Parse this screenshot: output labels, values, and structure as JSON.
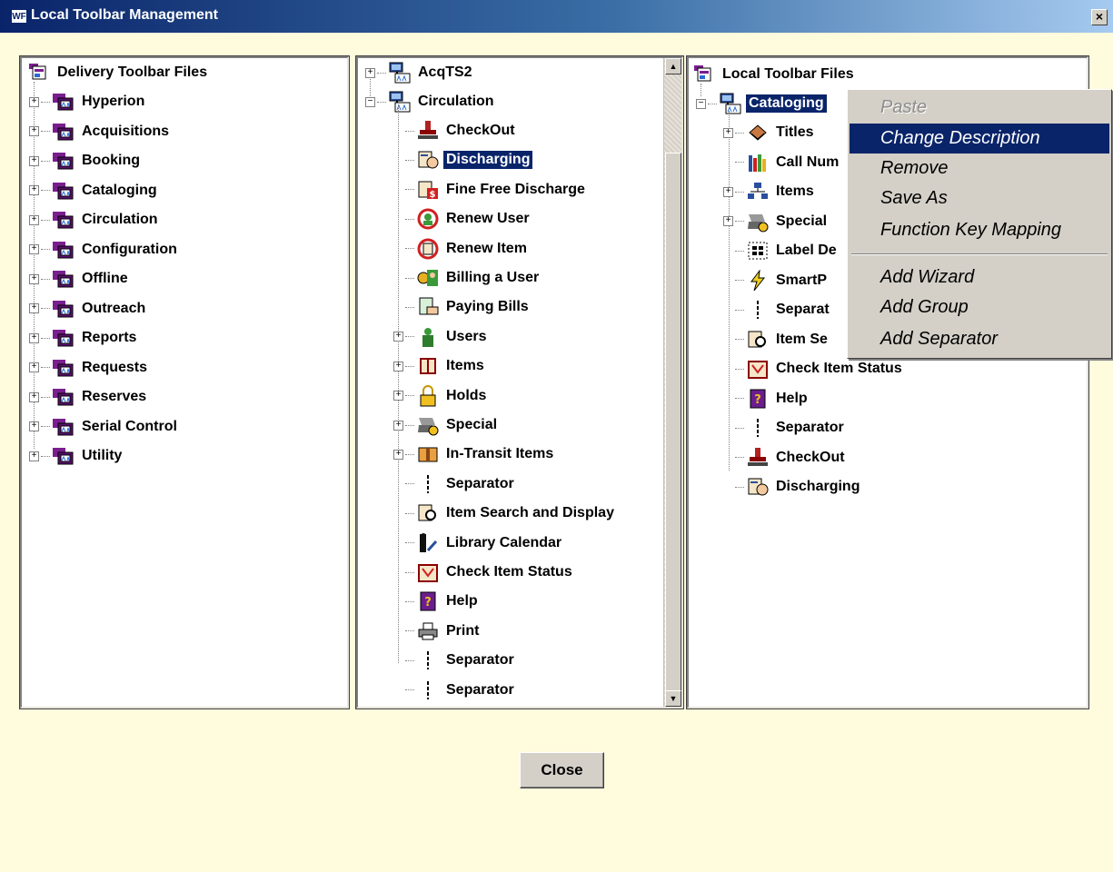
{
  "window": {
    "title": "Local Toolbar Management",
    "app_icon_text": "WF",
    "close_glyph": "×"
  },
  "left_panel": {
    "root": {
      "label": "Delivery Toolbar Files",
      "icon": "toolbar-files-icon"
    },
    "items": [
      {
        "label": "Hyperion",
        "icon": "toolbar-icon",
        "expanded": false
      },
      {
        "label": "Acquisitions",
        "icon": "toolbar-icon",
        "expanded": false
      },
      {
        "label": "Booking",
        "icon": "toolbar-icon",
        "expanded": false
      },
      {
        "label": "Cataloging",
        "icon": "toolbar-icon",
        "expanded": false
      },
      {
        "label": "Circulation",
        "icon": "toolbar-icon",
        "expanded": false
      },
      {
        "label": "Configuration",
        "icon": "toolbar-icon",
        "expanded": false
      },
      {
        "label": "Offline",
        "icon": "toolbar-icon",
        "expanded": false
      },
      {
        "label": "Outreach",
        "icon": "toolbar-icon",
        "expanded": false
      },
      {
        "label": "Reports",
        "icon": "toolbar-icon",
        "expanded": false
      },
      {
        "label": "Requests",
        "icon": "toolbar-icon",
        "expanded": false
      },
      {
        "label": "Reserves",
        "icon": "toolbar-icon",
        "expanded": false
      },
      {
        "label": "Serial Control",
        "icon": "toolbar-icon",
        "expanded": false
      },
      {
        "label": "Utility",
        "icon": "toolbar-icon",
        "expanded": false
      }
    ]
  },
  "middle_panel": {
    "top_items": [
      {
        "label": "AcqTS2",
        "icon": "network-icon",
        "expanded": false
      },
      {
        "label": "Circulation",
        "icon": "network-icon",
        "expanded": true
      }
    ],
    "children": [
      {
        "label": "CheckOut",
        "icon": "stamp-icon",
        "expandable": false,
        "selected": false
      },
      {
        "label": "Discharging",
        "icon": "discharge-icon",
        "expandable": false,
        "selected": true
      },
      {
        "label": "Fine Free Discharge",
        "icon": "fine-free-icon",
        "expandable": false,
        "selected": false
      },
      {
        "label": "Renew User",
        "icon": "renew-user-icon",
        "expandable": false,
        "selected": false
      },
      {
        "label": "Renew Item",
        "icon": "renew-item-icon",
        "expandable": false,
        "selected": false
      },
      {
        "label": "Billing a User",
        "icon": "billing-icon",
        "expandable": false,
        "selected": false
      },
      {
        "label": "Paying Bills",
        "icon": "paying-icon",
        "expandable": false,
        "selected": false
      },
      {
        "label": "Users",
        "icon": "user-icon",
        "expandable": true,
        "selected": false
      },
      {
        "label": "Items",
        "icon": "book-icon",
        "expandable": true,
        "selected": false
      },
      {
        "label": "Holds",
        "icon": "lock-icon",
        "expandable": true,
        "selected": false
      },
      {
        "label": "Special",
        "icon": "special-icon",
        "expandable": true,
        "selected": false
      },
      {
        "label": "In-Transit Items",
        "icon": "transit-icon",
        "expandable": true,
        "selected": false
      },
      {
        "label": "Separator",
        "icon": "separator-icon",
        "expandable": false,
        "selected": false
      },
      {
        "label": "Item Search and Display",
        "icon": "item-search-icon",
        "expandable": false,
        "selected": false
      },
      {
        "label": "Library Calendar",
        "icon": "calendar-icon",
        "expandable": false,
        "selected": false
      },
      {
        "label": "Check Item Status",
        "icon": "item-status-icon",
        "expandable": false,
        "selected": false
      },
      {
        "label": "Help",
        "icon": "help-icon",
        "expandable": false,
        "selected": false
      },
      {
        "label": "Print",
        "icon": "printer-icon",
        "expandable": false,
        "selected": false
      },
      {
        "label": "Separator",
        "icon": "separator-icon",
        "expandable": false,
        "selected": false
      },
      {
        "label": "Separator",
        "icon": "separator-icon",
        "expandable": false,
        "selected": false
      }
    ]
  },
  "right_panel": {
    "root": {
      "label": "Local Toolbar Files",
      "icon": "toolbar-files-icon"
    },
    "group": {
      "label": "Cataloging",
      "icon": "network-icon",
      "selected": true
    },
    "children": [
      {
        "label": "Titles",
        "icon": "titles-icon",
        "expandable": true
      },
      {
        "label": "Call Num",
        "icon": "call-number-icon",
        "expandable": false
      },
      {
        "label": "Items",
        "icon": "items-tree-icon",
        "expandable": true
      },
      {
        "label": "Special",
        "icon": "special-icon",
        "expandable": true
      },
      {
        "label": "Label De",
        "icon": "label-icon",
        "expandable": false
      },
      {
        "label": "SmartP",
        "icon": "lightning-icon",
        "expandable": false
      },
      {
        "label": "Separat",
        "icon": "separator-icon",
        "expandable": false
      },
      {
        "label": "Item Se",
        "icon": "item-search-icon",
        "expandable": false
      },
      {
        "label": "Check Item Status",
        "icon": "item-status-icon",
        "expandable": false
      },
      {
        "label": "Help",
        "icon": "help-icon",
        "expandable": false
      },
      {
        "label": "Separator",
        "icon": "separator-icon",
        "expandable": false
      },
      {
        "label": "CheckOut",
        "icon": "stamp-icon",
        "expandable": false
      },
      {
        "label": "Discharging",
        "icon": "discharge-icon",
        "expandable": false
      }
    ]
  },
  "context_menu": {
    "items": [
      {
        "label": "Paste",
        "disabled": true,
        "highlighted": false
      },
      {
        "label": "Change Description",
        "disabled": false,
        "highlighted": true
      },
      {
        "label": "Remove",
        "disabled": false,
        "highlighted": false
      },
      {
        "label": "Save As",
        "disabled": false,
        "highlighted": false
      },
      {
        "label": "Function Key Mapping",
        "disabled": false,
        "highlighted": false
      },
      {
        "label": "Add Wizard",
        "disabled": false,
        "highlighted": false
      },
      {
        "label": "Add Group",
        "disabled": false,
        "highlighted": false
      },
      {
        "label": "Add Separator",
        "disabled": false,
        "highlighted": false
      }
    ]
  },
  "footer": {
    "close_label": "Close"
  },
  "colors": {
    "background": "#FFFBDD",
    "selection": "#0A246A",
    "toolbar_purple": "#7A1E8E",
    "menu_bg": "#D4D0C8"
  }
}
